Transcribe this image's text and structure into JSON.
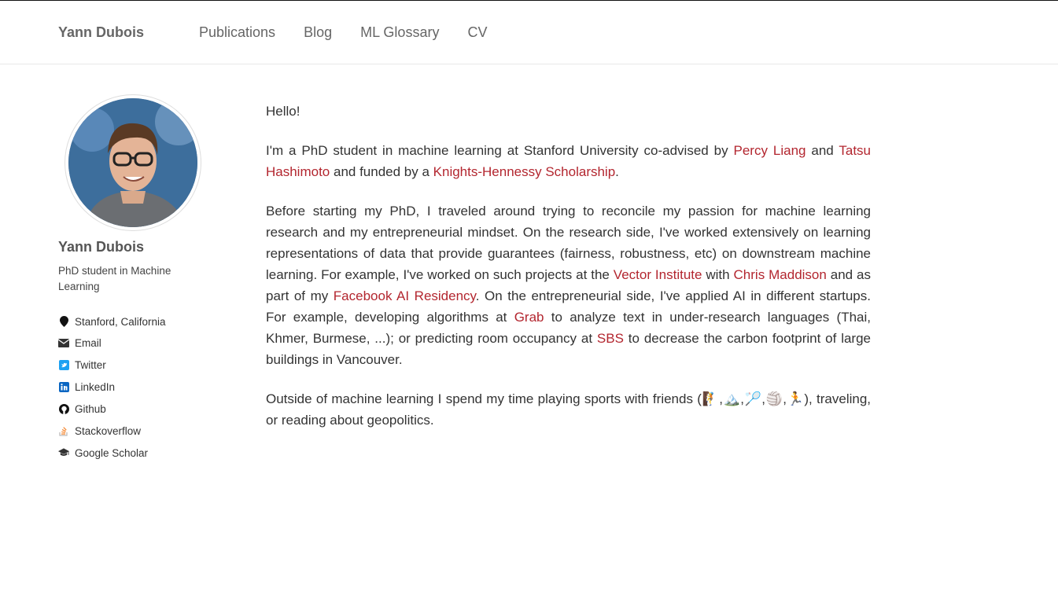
{
  "header": {
    "site_title": "Yann Dubois",
    "nav": [
      "Publications",
      "Blog",
      "ML Glossary",
      "CV"
    ]
  },
  "sidebar": {
    "name": "Yann Dubois",
    "bio": "PhD student in Machine Learning",
    "location": "Stanford, California",
    "links": {
      "email": "Email",
      "twitter": "Twitter",
      "linkedin": "LinkedIn",
      "github": "Github",
      "stackoverflow": "Stackoverflow",
      "scholar": "Google Scholar"
    }
  },
  "content": {
    "greeting": "Hello!",
    "p1": {
      "t1": "I'm a PhD student in machine learning at Stanford University co-advised by ",
      "l1": "Percy Liang",
      "t2": " and ",
      "l2": "Tatsu Hashimoto",
      "t3": " and funded by a ",
      "l3": "Knights-Hennessy Scholarship",
      "t4": "."
    },
    "p2": {
      "t1": "Before starting my PhD, I traveled around trying to reconcile my passion for machine learning research and my entrepreneurial mindset. On the research side, I've worked extensively on learning representations of data that provide guarantees (fairness, robustness, etc) on downstream machine learning. For example, I've worked on such projects at the ",
      "l1": "Vector Institute",
      "t2": " with ",
      "l2": "Chris Maddison",
      "t3": " and as part of my ",
      "l3": "Facebook AI Residency",
      "t4": ". On the entrepreneurial side, I've applied AI in different startups. For example, developing algorithms at ",
      "l4": "Grab",
      "t5": " to analyze text in under-research languages (Thai, Khmer, Burmese, ...); or predicting room occupancy at ",
      "l5": "SBS",
      "t6": " to decrease the carbon footprint of large buildings in Vancouver."
    },
    "p3": {
      "t1": "Outside of machine learning I spend my time playing sports with friends (",
      "emojis": "🧗,🏔️,🏸,🏐,🏃",
      "t2": "), traveling, or reading about geopolitics."
    }
  },
  "colors": {
    "link": "#b3262f",
    "nav_text": "#666666"
  }
}
